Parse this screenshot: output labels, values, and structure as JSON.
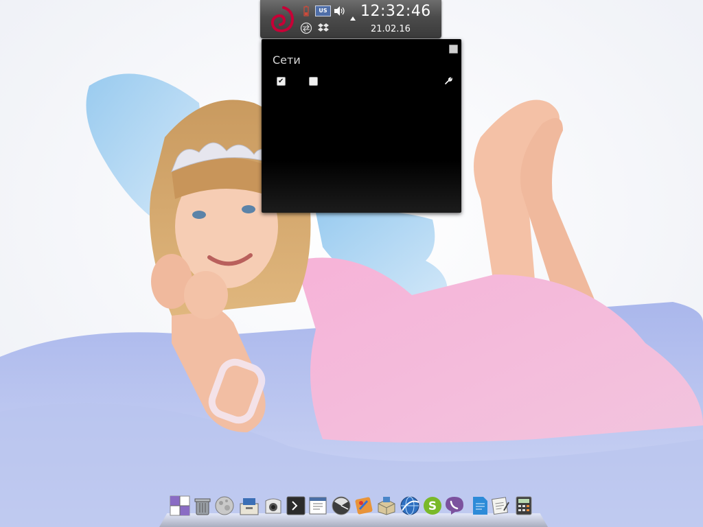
{
  "panel": {
    "clock_time": "12:32:46",
    "clock_date": "21.02.16",
    "keyboard_layout": "US",
    "tray_icons": [
      "debian-icon",
      "battery-icon",
      "keyboard-layout-icon",
      "volume-icon",
      "network-icon",
      "dropbox-icon",
      "expand-arrow-icon"
    ]
  },
  "network_popup": {
    "title": "Сети",
    "checkbox_1_checked": true,
    "checkbox_2_checked": false,
    "icons": [
      "pin-icon",
      "wrench-icon"
    ]
  },
  "dock": {
    "items": [
      {
        "name": "workspace-switcher-icon"
      },
      {
        "name": "trash-icon"
      },
      {
        "name": "moon-icon"
      },
      {
        "name": "file-manager-icon"
      },
      {
        "name": "camera-icon"
      },
      {
        "name": "terminal-icon"
      },
      {
        "name": "text-editor-icon"
      },
      {
        "name": "system-monitor-icon"
      },
      {
        "name": "paint-icon"
      },
      {
        "name": "archive-manager-icon"
      },
      {
        "name": "browser-icon"
      },
      {
        "name": "skype-icon"
      },
      {
        "name": "viber-icon"
      },
      {
        "name": "document-icon"
      },
      {
        "name": "notes-icon"
      },
      {
        "name": "calculator-icon"
      }
    ]
  },
  "colors": {
    "panel_bg": "#4b4b4b",
    "popup_bg": "#000000",
    "debian_red": "#c70036",
    "skype_green": "#7ab929",
    "viber_purple": "#7c529e"
  }
}
